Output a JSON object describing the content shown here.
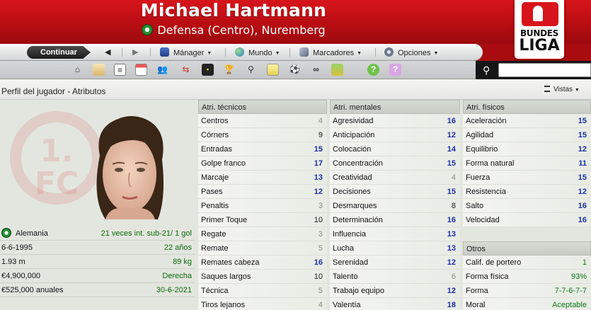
{
  "header": {
    "player_name": "Michael Hartmann",
    "position_club": "Defensa (Centro), Nuremberg",
    "league_logo_line1": "BUNDES",
    "league_logo_line2": "LIGA"
  },
  "toolbar": {
    "continue_label": "Continuar",
    "back_symbol": "◀",
    "forward_symbol": "▶",
    "menus": [
      {
        "label": "Mánager",
        "icon": "manager-icon"
      },
      {
        "label": "Mundo",
        "icon": "globe-icon"
      },
      {
        "label": "Marcadores",
        "icon": "bookmark-icon"
      },
      {
        "label": "Opciones",
        "icon": "options-icon"
      }
    ]
  },
  "icon_row": {
    "icons": [
      "home-icon",
      "inbox-icon",
      "news-icon",
      "calendar-icon",
      "squad-icon",
      "transfers-icon",
      "tactics-icon",
      "trophy-icon",
      "scouting-icon",
      "clipboard-icon",
      "training-icon",
      "binoculars-icon",
      "finances-icon",
      "help-icon",
      "question-icon"
    ],
    "search_placeholder": ""
  },
  "subheader": {
    "title": "Perfil del jugador - Atributos",
    "views_label": "Vistas"
  },
  "info": {
    "nationality": "Alemania",
    "caps": "21 veces int. sub-21/ 1 gol",
    "dob": "6-6-1995",
    "age": "22 años",
    "height": "1.93 m",
    "weight": "89 kg",
    "value": "€4,900,000",
    "foot": "Derecha",
    "wage": "€525,000 anuales",
    "contract": "30-6-2021"
  },
  "technical": {
    "title": "Atri. técnicos",
    "items": [
      {
        "name": "Centros",
        "value": "4"
      },
      {
        "name": "Córners",
        "value": "9"
      },
      {
        "name": "Entradas",
        "value": "15"
      },
      {
        "name": "Golpe franco",
        "value": "17"
      },
      {
        "name": "Marcaje",
        "value": "13"
      },
      {
        "name": "Pases",
        "value": "12"
      },
      {
        "name": "Penaltis",
        "value": "3"
      },
      {
        "name": "Primer Toque",
        "value": "10"
      },
      {
        "name": "Regate",
        "value": "3"
      },
      {
        "name": "Remate",
        "value": "5"
      },
      {
        "name": "Remates cabeza",
        "value": "16"
      },
      {
        "name": "Saques largos",
        "value": "10"
      },
      {
        "name": "Técnica",
        "value": "5"
      },
      {
        "name": "Tiros lejanos",
        "value": "4"
      }
    ]
  },
  "mental": {
    "title": "Atri. mentales",
    "items": [
      {
        "name": "Agresividad",
        "value": "16"
      },
      {
        "name": "Anticipación",
        "value": "12"
      },
      {
        "name": "Colocación",
        "value": "14"
      },
      {
        "name": "Concentración",
        "value": "15"
      },
      {
        "name": "Creatividad",
        "value": "4"
      },
      {
        "name": "Decisiones",
        "value": "15"
      },
      {
        "name": "Desmarques",
        "value": "8"
      },
      {
        "name": "Determinación",
        "value": "16"
      },
      {
        "name": "Influencia",
        "value": "13"
      },
      {
        "name": "Lucha",
        "value": "13"
      },
      {
        "name": "Serenidad",
        "value": "12"
      },
      {
        "name": "Talento",
        "value": "6"
      },
      {
        "name": "Trabajo equipo",
        "value": "12"
      },
      {
        "name": "Valentía",
        "value": "18"
      }
    ]
  },
  "physical": {
    "title": "Atri. físicos",
    "items": [
      {
        "name": "Aceleración",
        "value": "15"
      },
      {
        "name": "Agilidad",
        "value": "15"
      },
      {
        "name": "Equilibrio",
        "value": "12"
      },
      {
        "name": "Forma natural",
        "value": "11"
      },
      {
        "name": "Fuerza",
        "value": "15"
      },
      {
        "name": "Resistencia",
        "value": "12"
      },
      {
        "name": "Salto",
        "value": "16"
      },
      {
        "name": "Velocidad",
        "value": "16"
      }
    ]
  },
  "other": {
    "title": "Otros",
    "items": [
      {
        "name": "Calif. de portero",
        "value": "1"
      },
      {
        "name": "Forma física",
        "value": "93%"
      },
      {
        "name": "Forma",
        "value": "7-7-6-7-7"
      },
      {
        "name": "Moral",
        "value": "Aceptable"
      }
    ]
  }
}
